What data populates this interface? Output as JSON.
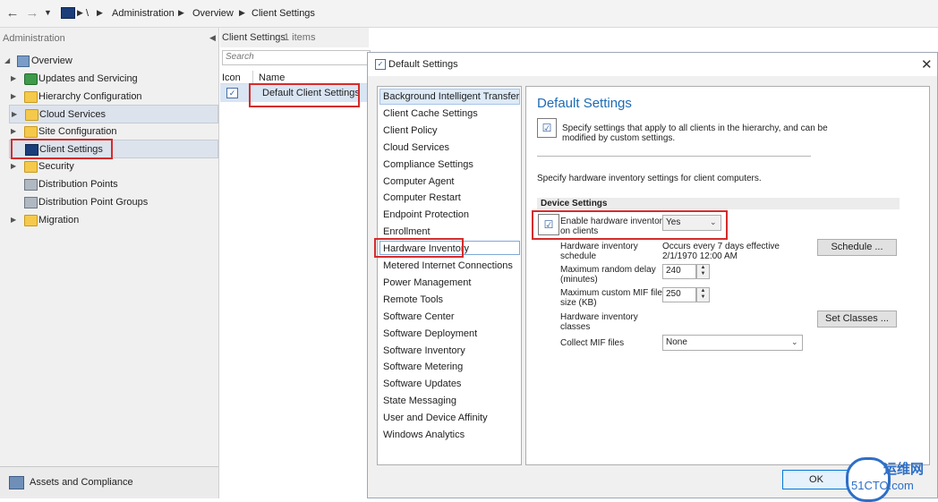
{
  "breadcrumb": [
    "\\",
    "Administration",
    "Overview",
    "Client Settings"
  ],
  "left_pane": {
    "title": "Administration",
    "items": [
      {
        "label": "Overview",
        "expand": "open",
        "icon": "overview-icon"
      },
      {
        "label": "Updates and Servicing",
        "expand": "closed",
        "icon": "updates-icon"
      },
      {
        "label": "Hierarchy Configuration",
        "expand": "closed",
        "icon": "folder-icon"
      },
      {
        "label": "Cloud Services",
        "expand": "closed",
        "icon": "folder-icon"
      },
      {
        "label": "Site Configuration",
        "expand": "closed",
        "icon": "folder-icon"
      },
      {
        "label": "Client Settings",
        "expand": "none",
        "icon": "client-settings-icon"
      },
      {
        "label": "Security",
        "expand": "closed",
        "icon": "folder-icon"
      },
      {
        "label": "Distribution Points",
        "expand": "none",
        "icon": "distribution-point-icon"
      },
      {
        "label": "Distribution Point Groups",
        "expand": "none",
        "icon": "distribution-group-icon"
      },
      {
        "label": "Migration",
        "expand": "closed",
        "icon": "folder-icon"
      }
    ],
    "workspace": "Assets and Compliance"
  },
  "mid_pane": {
    "title": "Client Settings",
    "count": "1 items",
    "search_placeholder": "Search",
    "columns": [
      "Icon",
      "Name"
    ],
    "rows": [
      {
        "name": "Default Client Settings"
      }
    ]
  },
  "dialog": {
    "title": "Default Settings",
    "nav_items": [
      "Background Intelligent Transfer",
      "Client Cache Settings",
      "Client Policy",
      "Cloud Services",
      "Compliance Settings",
      "Computer Agent",
      "Computer Restart",
      "Endpoint Protection",
      "Enrollment",
      "Hardware Inventory",
      "Metered Internet Connections",
      "Power Management",
      "Remote Tools",
      "Software Center",
      "Software Deployment",
      "Software Inventory",
      "Software Metering",
      "Software Updates",
      "State Messaging",
      "User and Device Affinity",
      "Windows Analytics"
    ],
    "selected_item": "Hardware Inventory",
    "content_title": "Default Settings",
    "intro_line1": "Specify settings that apply to all clients in the hierarchy, and can be",
    "intro_line2": "modified by custom settings.",
    "hint": "Specify hardware inventory settings for client computers.",
    "section": "Device Settings",
    "enable_label_1": "Enable hardware inventory",
    "enable_label_2": "on clients",
    "enable_value": "Yes",
    "schedule_label_1": "Hardware inventory",
    "schedule_label_2": "schedule",
    "schedule_value_1": "Occurs every 7 days effective",
    "schedule_value_2": "2/1/1970 12:00 AM",
    "schedule_button": "Schedule ...",
    "max_delay_label_1": "Maximum random delay",
    "max_delay_label_2": "(minutes)",
    "max_delay_value": "240",
    "max_mif_label_1": "Maximum custom MIF file",
    "max_mif_label_2": "size (KB)",
    "max_mif_value": "250",
    "classes_label_1": "Hardware inventory",
    "classes_label_2": "classes",
    "classes_button": "Set Classes ...",
    "collect_mif_label": "Collect MIF files",
    "collect_mif_value": "None",
    "ok_button": "OK",
    "watermark_line1": "运维网",
    "watermark_line2": "51CTO.com"
  }
}
